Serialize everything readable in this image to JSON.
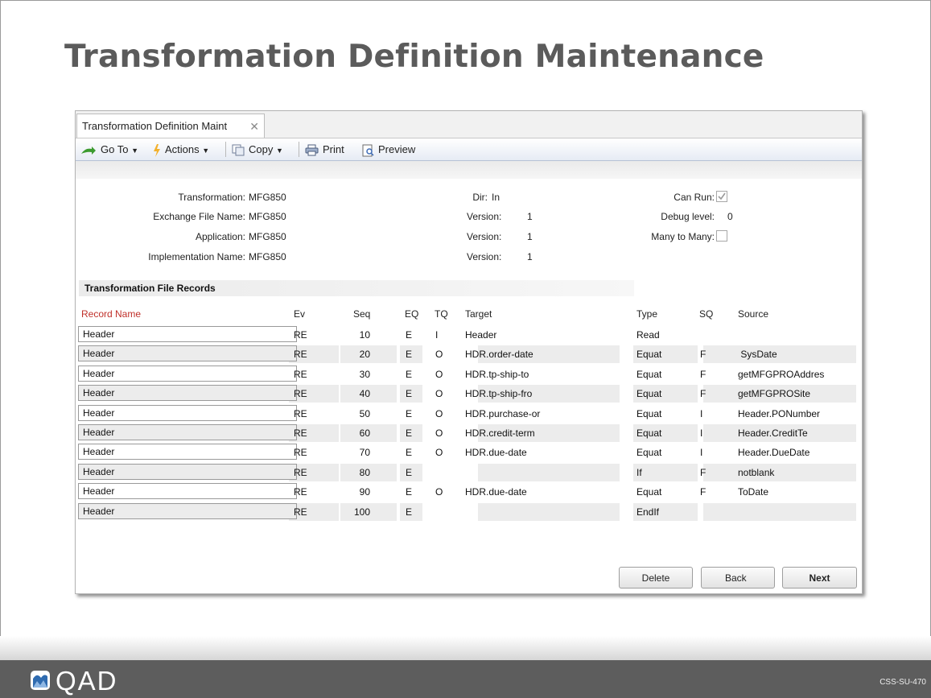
{
  "slide": {
    "title": "Transformation Definition Maintenance",
    "code": "CSS-SU-470"
  },
  "tab": {
    "label": "Transformation Definition Maint",
    "close": "✕"
  },
  "toolbar": {
    "goto": "Go To",
    "actions": "Actions",
    "copy": "Copy",
    "print": "Print",
    "preview": "Preview"
  },
  "form": {
    "transformation_label": "Transformation:",
    "transformation": "MFG850",
    "exchange_label": "Exchange File Name:",
    "exchange": "MFG850",
    "application_label": "Application:",
    "application": "MFG850",
    "implementation_label": "Implementation Name:",
    "implementation": "MFG850",
    "dir_label": "Dir:",
    "dir": "In",
    "version_label": "Version:",
    "version1": "1",
    "version2": "1",
    "version3": "1",
    "can_run_label": "Can Run:",
    "can_run": true,
    "debug_label": "Debug level:",
    "debug": "0",
    "many_label": "Many to Many:",
    "many": false
  },
  "records": {
    "section": "Transformation File Records",
    "headers": {
      "record": "Record Name",
      "ev": "Ev",
      "seq": "Seq",
      "eq": "EQ",
      "tq": "TQ",
      "target": "Target",
      "type": "Type",
      "sq": "SQ",
      "source": "Source"
    },
    "rows": [
      {
        "record": "Header",
        "ev": "RE",
        "seq": "10",
        "eq": "E",
        "tq": "I",
        "target": "Header",
        "type": "Read",
        "sq": "",
        "source": ""
      },
      {
        "record": "Header",
        "ev": "RE",
        "seq": "20",
        "eq": "E",
        "tq": "O",
        "target": "HDR.order-date",
        "type": "Equat",
        "sq": "F",
        "source": " SysDate"
      },
      {
        "record": "Header",
        "ev": "RE",
        "seq": "30",
        "eq": "E",
        "tq": "O",
        "target": "HDR.tp-ship-to",
        "type": "Equat",
        "sq": "F",
        "source": "getMFGPROAddres"
      },
      {
        "record": "Header",
        "ev": "RE",
        "seq": "40",
        "eq": "E",
        "tq": "O",
        "target": "HDR.tp-ship-fro",
        "type": "Equat",
        "sq": "F",
        "source": "getMFGPROSite"
      },
      {
        "record": "Header",
        "ev": "RE",
        "seq": "50",
        "eq": "E",
        "tq": "O",
        "target": "HDR.purchase-or",
        "type": "Equat",
        "sq": "I",
        "source": "Header.PONumber"
      },
      {
        "record": "Header",
        "ev": "RE",
        "seq": "60",
        "eq": "E",
        "tq": "O",
        "target": "HDR.credit-term",
        "type": "Equat",
        "sq": "I",
        "source": "Header.CreditTe"
      },
      {
        "record": "Header",
        "ev": "RE",
        "seq": "70",
        "eq": "E",
        "tq": "O",
        "target": "HDR.due-date",
        "type": "Equat",
        "sq": "I",
        "source": "Header.DueDate"
      },
      {
        "record": "Header",
        "ev": "RE",
        "seq": "80",
        "eq": "E",
        "tq": "",
        "target": "",
        "type": "If",
        "sq": "F",
        "source": "notblank"
      },
      {
        "record": "Header",
        "ev": "RE",
        "seq": "90",
        "eq": "E",
        "tq": "O",
        "target": "HDR.due-date",
        "type": "Equat",
        "sq": "F",
        "source": "ToDate"
      },
      {
        "record": "Header",
        "ev": "RE",
        "seq": "100",
        "eq": "E",
        "tq": "",
        "target": "",
        "type": "EndIf",
        "sq": "",
        "source": ""
      }
    ]
  },
  "buttons": {
    "delete": "Delete",
    "back": "Back",
    "next": "Next"
  },
  "brand": {
    "logo_text": "QAD",
    "record_header_color": "#c0302a"
  }
}
